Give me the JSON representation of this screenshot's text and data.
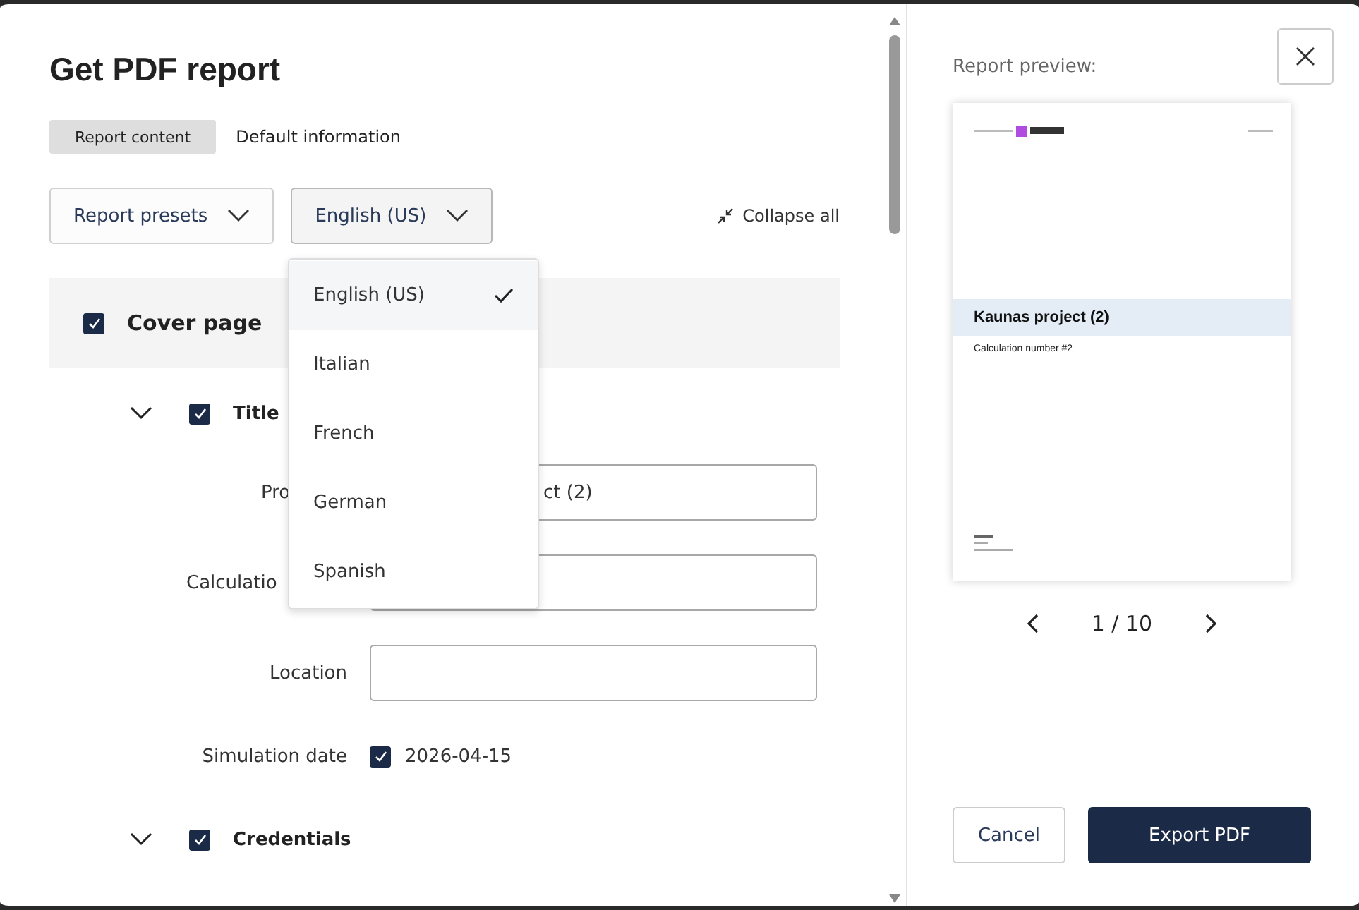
{
  "dialog": {
    "title": "Get PDF report"
  },
  "tabs": [
    {
      "label": "Report content",
      "selected": true
    },
    {
      "label": "Default information",
      "selected": false
    }
  ],
  "toolbar": {
    "presets": "Report presets",
    "language": "English (US)",
    "collapse": "Collapse all"
  },
  "language_menu": [
    {
      "label": "English (US)",
      "selected": true
    },
    {
      "label": "Italian",
      "selected": false
    },
    {
      "label": "French",
      "selected": false
    },
    {
      "label": "German",
      "selected": false
    },
    {
      "label": "Spanish",
      "selected": false
    }
  ],
  "section": {
    "title": "Cover page",
    "checked": true,
    "children": [
      {
        "title": "Title",
        "checked": true,
        "expanded": true,
        "fields": [
          {
            "kind": "text",
            "label": "Pro",
            "value": "ct (2)"
          },
          {
            "kind": "text",
            "label": "Calculatio"
          },
          {
            "kind": "text",
            "label": "Location"
          },
          {
            "kind": "check",
            "label": "Simulation date",
            "checked": true,
            "value": "2026-04-15"
          }
        ]
      },
      {
        "title": "Credentials",
        "checked": true,
        "expanded": true
      }
    ]
  },
  "preview": {
    "label": "Report preview:",
    "page_title": "Kaunas project (2)",
    "page_subtitle": "Calculation number #2",
    "pager": "1 / 10"
  },
  "buttons": {
    "cancel": "Cancel",
    "export": "Export PDF"
  }
}
